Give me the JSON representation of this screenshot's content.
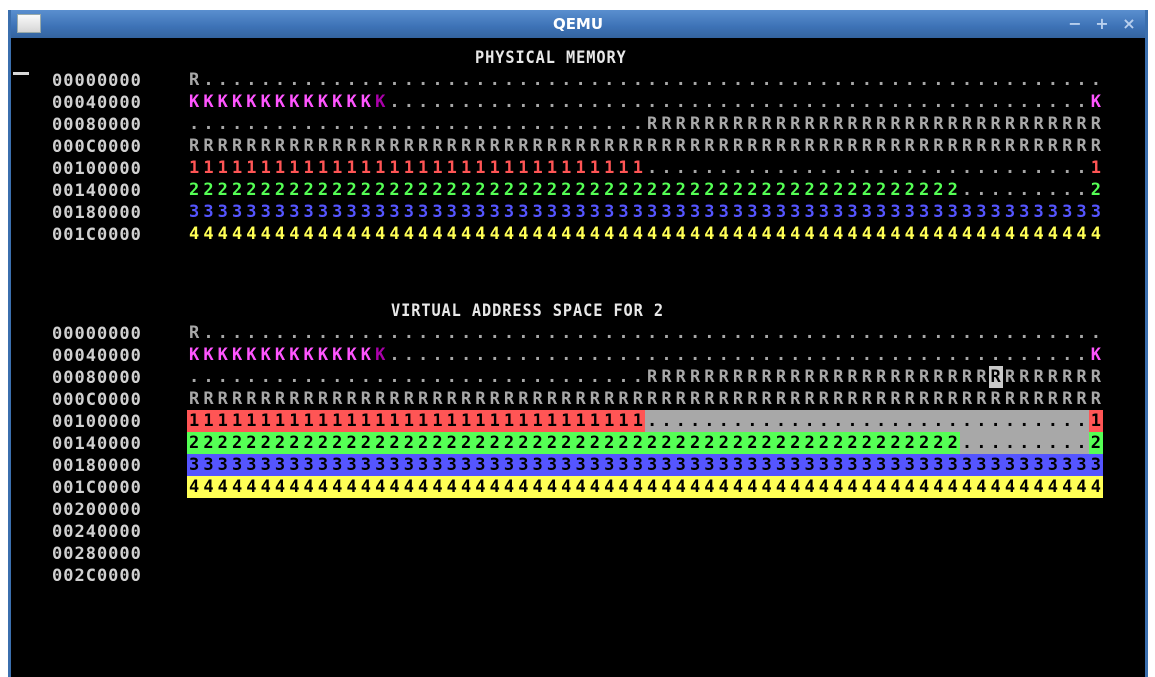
{
  "window": {
    "title": "QEMU",
    "min_glyph": "−",
    "max_glyph": "+",
    "close_glyph": "×"
  },
  "physical_memory": {
    "heading": "PHYSICAL MEMORY",
    "rows": [
      {
        "addr": "00000000",
        "cells": "R..............................................................."
      },
      {
        "addr": "00040000",
        "cells": "KKKKKKKKKKKKKK.................................................K"
      },
      {
        "addr": "00080000",
        "cells": "................................RRRRRRRRRRRRRRRRRRRRRRRRRRRRRRRR"
      },
      {
        "addr": "000C0000",
        "cells": "RRRRRRRRRRRRRRRRRRRRRRRRRRRRRRRRRRRRRRRRRRRRRRRRRRRRRRRRRRRRRRRR"
      },
      {
        "addr": "00100000",
        "cells": "11111111111111111111111111111111...............................1"
      },
      {
        "addr": "00140000",
        "cells": "222222222222222222222222222222222222222222222222222222.........2"
      },
      {
        "addr": "00180000",
        "cells": "3333333333333333333333333333333333333333333333333333333333333333"
      },
      {
        "addr": "001C0000",
        "cells": "4444444444444444444444444444444444444444444444444444444444444444"
      }
    ]
  },
  "virtual_address_space": {
    "heading": "VIRTUAL ADDRESS SPACE FOR 2",
    "rows": [
      {
        "addr": "00000000",
        "cells": "R..............................................................."
      },
      {
        "addr": "00040000",
        "cells": "KKKKKKKKKKKKKK.................................................K"
      },
      {
        "addr": "00080000",
        "cells": "................................RRRRRRRRRRRRRRRRRRRRRRRRRRRRRRRR"
      },
      {
        "addr": "000C0000",
        "cells": "RRRRRRRRRRRRRRRRRRRRRRRRRRRRRRRRRRRRRRRRRRRRRRRRRRRRRRRRRRRRRRRR"
      },
      {
        "addr": "00100000",
        "cells": "11111111111111111111111111111111...............................1"
      },
      {
        "addr": "00140000",
        "cells": "222222222222222222222222222222222222222222222222222222.........2"
      },
      {
        "addr": "00180000",
        "cells": "3333333333333333333333333333333333333333333333333333333333333333"
      },
      {
        "addr": "001C0000",
        "cells": "4444444444444444444444444444444444444444444444444444444444444444"
      },
      {
        "addr": "00200000",
        "cells": ""
      },
      {
        "addr": "00240000",
        "cells": ""
      },
      {
        "addr": "00280000",
        "cells": ""
      },
      {
        "addr": "002C0000",
        "cells": ""
      }
    ]
  },
  "palette": {
    "R": "#a8a8a8",
    "dot": "#a8a8a8",
    "K": "#ff55ff",
    "K_dim": "#aa00aa",
    "1": "#ff5555",
    "2": "#55ff55",
    "3": "#5555ff",
    "4": "#ffff55",
    "dark_text": "#000000",
    "highlight_gray": "#a8a8a8",
    "highlight_red": "#ff5555",
    "highlight_green": "#55ff55",
    "highlight_blue": "#5555ff",
    "highlight_yellow": "#ffff55"
  }
}
